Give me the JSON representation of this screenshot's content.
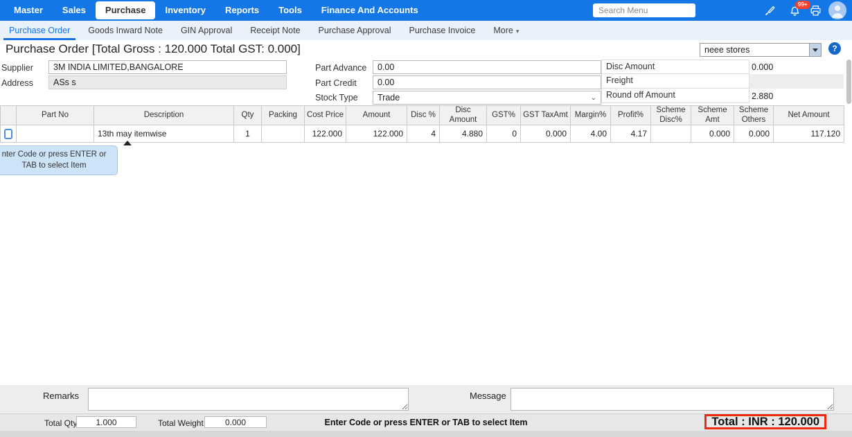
{
  "colors": {
    "navbar_blue": "#1377e8",
    "subnav_bg": "#e9f1fb",
    "active_link_blue": "#1673e6",
    "highlight_red": "#ee2b10"
  },
  "topnav": {
    "items": [
      {
        "label": "Master"
      },
      {
        "label": "Sales"
      },
      {
        "label": "Purchase"
      },
      {
        "label": "Inventory"
      },
      {
        "label": "Reports"
      },
      {
        "label": "Tools"
      },
      {
        "label": "Finance And Accounts"
      }
    ],
    "active_item": "Purchase",
    "search_placeholder": "Search Menu",
    "notification_badge": "99+",
    "icons": [
      "brush-icon",
      "bell-icon",
      "printer-icon",
      "avatar"
    ]
  },
  "subnav": {
    "items": [
      {
        "label": "Purchase Order"
      },
      {
        "label": "Goods Inward Note"
      },
      {
        "label": "GIN Approval"
      },
      {
        "label": "Receipt Note"
      },
      {
        "label": "Purchase Approval"
      },
      {
        "label": "Purchase Invoice"
      },
      {
        "label": "More"
      }
    ],
    "active_item": "Purchase Order"
  },
  "header": {
    "title": "Purchase Order [Total Gross : 120.000 Total GST: 0.000]",
    "store_selector_value": "neee stores",
    "help_icon": "?"
  },
  "form": {
    "supplier": {
      "label": "Supplier",
      "value": "3M INDIA LIMITED,BANGALORE"
    },
    "address": {
      "label": "Address",
      "value": "ASs s"
    },
    "part_advance": {
      "label": "Part Advance",
      "value": "0.00"
    },
    "part_credit": {
      "label": "Part Credit",
      "value": "0.00"
    },
    "stock_type": {
      "label": "Stock Type",
      "value": "Trade"
    },
    "disc_amount": {
      "label": "Disc Amount",
      "value": "0.000"
    },
    "freight": {
      "label": "Freight",
      "value": ""
    },
    "round_off": {
      "label": "Round off Amount",
      "value": "2.880"
    }
  },
  "grid": {
    "columns": [
      "Part No",
      "Description",
      "Qty",
      "Packing",
      "Cost Price",
      "Amount",
      "Disc %",
      "Disc Amount",
      "GST%",
      "GST TaxAmt",
      "Margin%",
      "Profit%",
      "Scheme Disc%",
      "Scheme Amt",
      "Scheme Others",
      "Net Amount"
    ],
    "row": [
      "",
      "13th may itemwise",
      "1",
      "",
      "122.000",
      "122.000",
      "4",
      "4.880",
      "0",
      "0.000",
      "4.00",
      "4.17",
      "",
      "0.000",
      "0.000",
      "117.120"
    ]
  },
  "tooltip": {
    "text": "nter Code or press ENTER or TAB to select Item"
  },
  "remarks": {
    "label": "Remarks",
    "value": ""
  },
  "message": {
    "label": "Message",
    "value": ""
  },
  "footer": {
    "total_qty": {
      "label": "Total Qty",
      "value": "1.000"
    },
    "total_weight": {
      "label": "Total Weight",
      "value": "0.000"
    },
    "hint": "Enter Code or press ENTER or TAB to select Item",
    "grand_total": "Total : INR : 120.000"
  }
}
